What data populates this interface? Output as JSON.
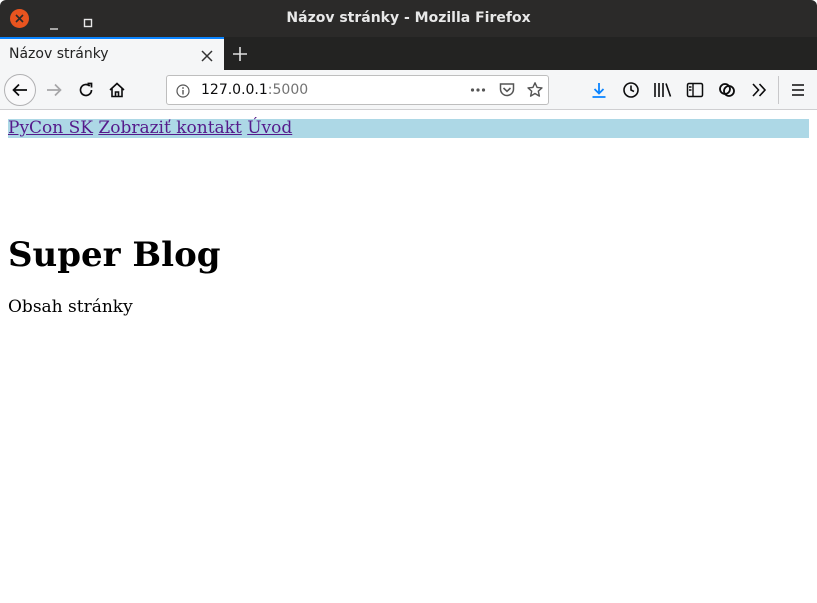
{
  "window": {
    "title": "Názov stránky - Mozilla Firefox"
  },
  "tabs": [
    {
      "label": "Názov stránky",
      "active": true
    }
  ],
  "urlbar": {
    "host": "127.0.0.1",
    "port": ":5000"
  },
  "icons": {
    "back": "back-arrow-icon",
    "forward": "forward-arrow-icon",
    "reload": "reload-icon",
    "home": "home-icon",
    "info": "info-icon",
    "page_actions": "more-dots-icon",
    "pocket": "pocket-icon",
    "bookmark": "star-icon",
    "downloads": "download-icon",
    "history": "clock-icon",
    "library": "library-icon",
    "sidebar": "sidebar-icon",
    "sync": "sync-icon",
    "overflow": "double-chevron-icon",
    "menu": "hamburger-menu-icon"
  },
  "colors": {
    "accent": "#0a84ff",
    "download_icon": "#0a84ff",
    "nav_background": "#add8e6",
    "link_visited": "#551a8b",
    "close_button": "#e9541f"
  },
  "page": {
    "nav_links": [
      "PyCon SK",
      "Zobraziť kontakt",
      "Úvod"
    ],
    "heading": "Super Blog",
    "body_text": "Obsah stránky"
  }
}
